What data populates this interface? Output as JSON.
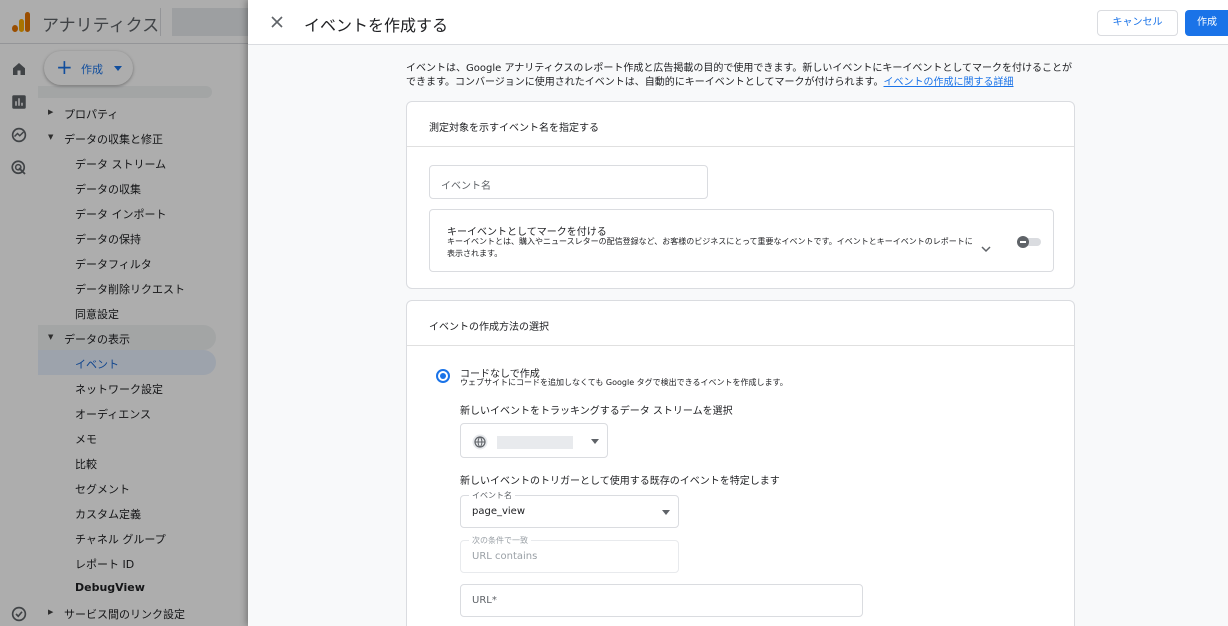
{
  "app": {
    "title": "アナリティクス",
    "create_label": "作成"
  },
  "nav": {
    "items": [
      {
        "label": "プロパティ",
        "level": 1,
        "expander": "collapsed"
      },
      {
        "label": "データの収集と修正",
        "level": 1,
        "expander": "expanded"
      },
      {
        "label": "データ ストリーム",
        "level": 2
      },
      {
        "label": "データの収集",
        "level": 2
      },
      {
        "label": "データ インポート",
        "level": 2
      },
      {
        "label": "データの保持",
        "level": 2
      },
      {
        "label": "データフィルタ",
        "level": 2
      },
      {
        "label": "データ削除リクエスト",
        "level": 2
      },
      {
        "label": "同意設定",
        "level": 2
      },
      {
        "label": "データの表示",
        "level": 1,
        "expander": "expanded",
        "group": true
      },
      {
        "label": "イベント",
        "level": 2,
        "selected": true
      },
      {
        "label": "ネットワーク設定",
        "level": 2
      },
      {
        "label": "オーディエンス",
        "level": 2
      },
      {
        "label": "メモ",
        "level": 2
      },
      {
        "label": "比較",
        "level": 2
      },
      {
        "label": "セグメント",
        "level": 2
      },
      {
        "label": "カスタム定義",
        "level": 2
      },
      {
        "label": "チャネル グループ",
        "level": 2
      },
      {
        "label": "レポート ID",
        "level": 2
      },
      {
        "label": "DebugView",
        "level": 2,
        "bold": true
      },
      {
        "label": "サービス間のリンク設定",
        "level": 1,
        "expander": "collapsed"
      }
    ]
  },
  "dialog": {
    "title": "イベントを作成する",
    "cancel_label": "キャンセル",
    "create_label": "作成",
    "intro_text": "イベントは、Google アナリティクスのレポート作成と広告掲載の目的で使用できます。新しいイベントにキーイベントとしてマークを付けることができます。コンバージョンに使用されたイベントは、自動的にキーイベントとしてマークが付けられます。",
    "intro_link": "イベントの作成に関する詳細",
    "section1": {
      "title": "測定対象を示すイベント名を指定する",
      "event_name_placeholder": "イベント名",
      "key_event_title": "キーイベントとしてマークを付ける",
      "key_event_desc": "キーイベントとは、購入やニュースレターの配信登録など、お客様のビジネスにとって重要なイベントです。イベントとキーイベントのレポートに表示されます。",
      "key_event_enabled": false
    },
    "section2": {
      "title": "イベントの作成方法の選択",
      "option_title": "コードなしで作成",
      "option_desc": "ウェブサイトにコードを追加しなくても Google タグで検出できるイベントを作成します。",
      "option_selected": true,
      "stream_label": "新しいイベントをトラッキングするデータ ストリームを選択",
      "trigger_label": "新しいイベントのトリガーとして使用する既存のイベントを特定します",
      "event_field_legend": "イベント名",
      "event_field_value": "page_view",
      "condition_legend": "次の条件で一致",
      "condition_value": "URL contains",
      "url_placeholder": "URL*"
    }
  },
  "icons": {
    "close": "close-icon",
    "chevron": "chevron-down-icon",
    "globe": "globe-icon",
    "home": "home-icon",
    "reports": "bar-chart-icon",
    "explore": "explore-icon",
    "advertising": "target-icon",
    "admin": "check-circle-icon"
  },
  "colors": {
    "accent": "#1a73e8",
    "overlay": "rgba(0,0,0,0.32)"
  }
}
